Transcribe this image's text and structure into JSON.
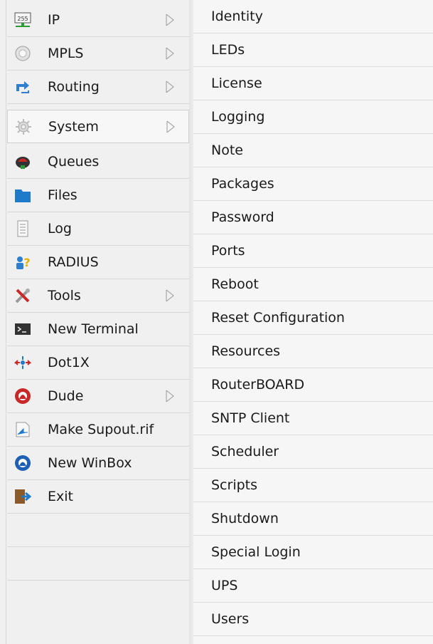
{
  "left_menu": [
    {
      "label": "IP",
      "icon": "ip-icon",
      "submenu": true
    },
    {
      "label": "MPLS",
      "icon": "mpls-icon",
      "submenu": true
    },
    {
      "label": "Routing",
      "icon": "routing-icon",
      "submenu": true
    },
    {
      "label": "System",
      "icon": "system-icon",
      "submenu": true
    },
    {
      "label": "Queues",
      "icon": "queues-icon",
      "submenu": false
    },
    {
      "label": "Files",
      "icon": "files-icon",
      "submenu": false
    },
    {
      "label": "Log",
      "icon": "log-icon",
      "submenu": false
    },
    {
      "label": "RADIUS",
      "icon": "radius-icon",
      "submenu": false
    },
    {
      "label": "Tools",
      "icon": "tools-icon",
      "submenu": true
    },
    {
      "label": "New Terminal",
      "icon": "terminal-icon",
      "submenu": false
    },
    {
      "label": "Dot1X",
      "icon": "dot1x-icon",
      "submenu": false
    },
    {
      "label": "Dude",
      "icon": "dude-icon",
      "submenu": true
    },
    {
      "label": "Make Supout.rif",
      "icon": "supout-icon",
      "submenu": false
    },
    {
      "label": "New WinBox",
      "icon": "winbox-icon",
      "submenu": false
    },
    {
      "label": "Exit",
      "icon": "exit-icon",
      "submenu": false
    }
  ],
  "submenu_items": [
    "Identity",
    "LEDs",
    "License",
    "Logging",
    "Note",
    "Packages",
    "Password",
    "Ports",
    "Reboot",
    "Reset Configuration",
    "Resources",
    "RouterBOARD",
    "SNTP Client",
    "Scheduler",
    "Scripts",
    "Shutdown",
    "Special Login",
    "UPS",
    "Users"
  ],
  "colors": {
    "menu_bg": "#f0f0f0",
    "submenu_bg": "#f6f6f6",
    "separator": "#d8d8d8",
    "accent_blue": "#1f7ac9",
    "accent_red": "#c82828"
  }
}
